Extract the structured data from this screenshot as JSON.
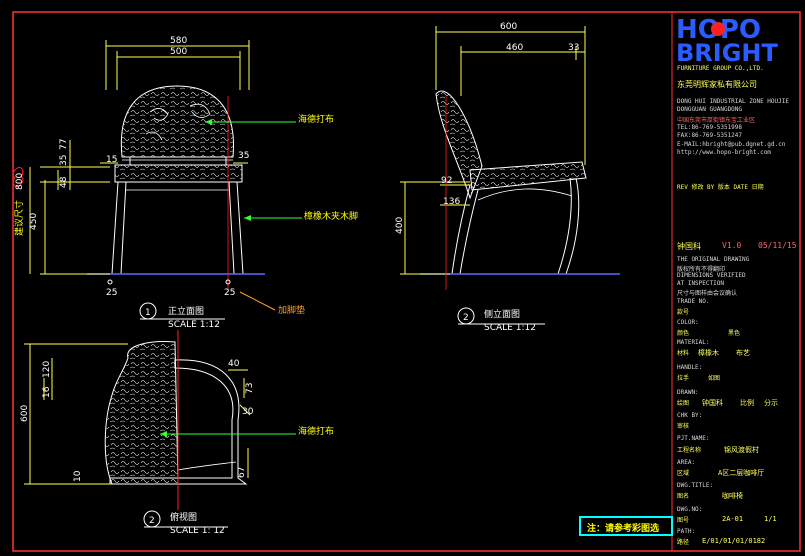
{
  "colors": {
    "bg": "#000000",
    "border": "#ff3333",
    "line": "#ffffff",
    "dim": "#ffff55",
    "red": "#ff2020",
    "green": "#33ff33",
    "blue": "#6666ff",
    "yellow": "#ffff00",
    "cyan": "#00ffff",
    "orange": "#ffa020",
    "logo": "#2a5cff"
  },
  "views": {
    "front": {
      "num": "1",
      "title": "正立面图",
      "scale": "SCALE 1:12"
    },
    "side": {
      "num": "2",
      "title": "侧立面图",
      "scale": "SCALE 1:12"
    },
    "top": {
      "num": "2",
      "title": "俯视图",
      "scale": "SCALE 1: 12"
    }
  },
  "dims": {
    "front": {
      "w_total": "580",
      "w_inner": "500",
      "seat_total": "800",
      "seat_label": "建议尺寸",
      "seat_h": "450",
      "d48": "48",
      "d35a": "35",
      "d77": "77",
      "d15": "15",
      "d35b": "35",
      "foot_l": "25",
      "foot_r": "25"
    },
    "side": {
      "depth": "600",
      "d460": "460",
      "d33": "33",
      "d92": "92",
      "d136": "136",
      "h400": "400"
    },
    "top": {
      "d600": "600",
      "d120": "120",
      "d16": "16",
      "d40": "40",
      "d73": "73",
      "d30": "30",
      "d10": "10",
      "d67": "67"
    }
  },
  "labels": {
    "fabric1": "海德打布",
    "wood": "樟橡木夹木脚",
    "glides": "加脚垫",
    "fabric2": "海德打布",
    "fabric3": "海德打布"
  },
  "note": "注：请参考彩图选",
  "title_block": {
    "logo_top": "HOPO",
    "logo_bottom": "BRIGHT",
    "group": "FURNITURE GROUP CO.,LTD.",
    "company_cn": "东莞明辉家私有限公司",
    "addr": [
      "DONG HUI INDUSTRIAL ZONE HOUJIE",
      "DONGGUAN GUANGDONG",
      "中国东莞市厚街镇东宝工业区",
      "TEL:86-769-5351998",
      "FAX:86-769-5351247",
      "E-MAIL:hbright@pub.dgnet.gd.cn",
      "http://www.hopo-bright.com"
    ],
    "rev_header": "REV 修改   BY 版本   DATE 日期",
    "revision": {
      "designer": "钟国科",
      "ver": "V1.0",
      "date": "05/11/15"
    },
    "legal": [
      "THE ORIGINAL DRAWING",
      "版权所有不得翻印",
      "DIMENSIONS VERIFIED",
      "AT INSPECTION",
      "尺寸与图样由会议确认"
    ],
    "fields": [
      {
        "en": "TRADE NO.",
        "cn": "款号",
        "val": ""
      },
      {
        "en": "COLOR:",
        "cn": "颜色",
        "val": "黑色"
      },
      {
        "en": "MATERIAL:",
        "cn": "材料",
        "val": "樟橡木",
        "val2": "布艺"
      },
      {
        "en": "HANDLE:",
        "cn": "拉手",
        "val": "如图"
      },
      {
        "en": "DRAWN:",
        "cn": "绘图",
        "val": "钟国科",
        "extra": "比例",
        "extra2": "分示"
      },
      {
        "en": "CHK BY:",
        "cn": "审核",
        "val": ""
      },
      {
        "en": "PJT.NAME:",
        "cn": "工程名称",
        "val": "锦风渡假村"
      },
      {
        "en": "AREA:",
        "cn": "区域",
        "val": "A区二层咖啡厅"
      },
      {
        "en": "DWG.TITLE:",
        "cn": "图名",
        "val": "咖啡椅"
      },
      {
        "en": "DWG.NO:",
        "cn": "图号",
        "val": "2A-01",
        "page": "1/1"
      },
      {
        "en": "PATH:",
        "cn": "路径",
        "val": "E/01/01/01/0182"
      }
    ]
  }
}
